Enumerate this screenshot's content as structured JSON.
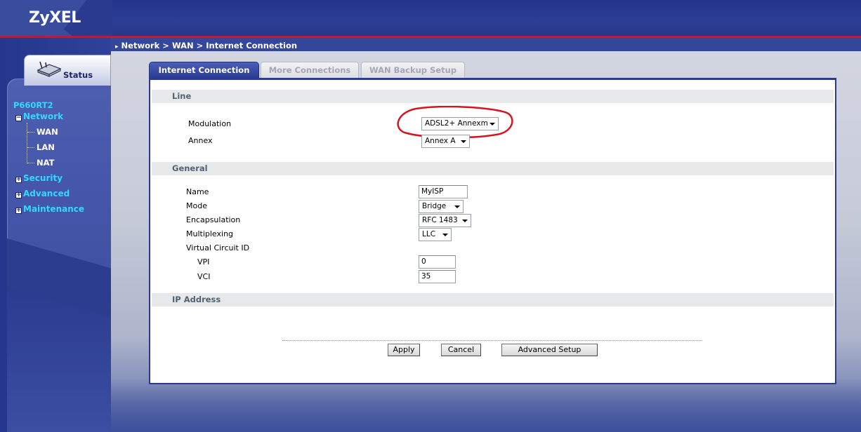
{
  "header": {
    "logo": "ZyXEL"
  },
  "breadcrumb": "Network > WAN > Internet Connection",
  "status_tab": {
    "label": "Status",
    "icon": "router-icon"
  },
  "sidebar": {
    "model": "P660RT2",
    "items": [
      {
        "label": "Network",
        "expanded": true,
        "children": [
          "WAN",
          "LAN",
          "NAT"
        ]
      },
      {
        "label": "Security",
        "expanded": false
      },
      {
        "label": "Advanced",
        "expanded": false
      },
      {
        "label": "Maintenance",
        "expanded": false
      }
    ]
  },
  "tabs": [
    {
      "label": "Internet Connection",
      "active": true
    },
    {
      "label": "More Connections",
      "active": false
    },
    {
      "label": "WAN Backup Setup",
      "active": false
    }
  ],
  "sections": {
    "line": "Line",
    "general": "General",
    "ip_address": "IP Address"
  },
  "line": {
    "modulation_label": "Modulation",
    "modulation_value": "ADSL2+ Annexm",
    "annex_label": "Annex",
    "annex_value": "Annex A"
  },
  "general": {
    "name_label": "Name",
    "name_value": "MyISP",
    "mode_label": "Mode",
    "mode_value": "Bridge",
    "encapsulation_label": "Encapsulation",
    "encapsulation_value": "RFC 1483",
    "multiplexing_label": "Multiplexing",
    "multiplexing_value": "LLC",
    "vc_label": "Virtual Circuit ID",
    "vpi_label": "VPI",
    "vpi_value": "0",
    "vci_label": "VCI",
    "vci_value": "35"
  },
  "buttons": {
    "apply": "Apply",
    "cancel": "Cancel",
    "advanced": "Advanced Setup"
  },
  "colors": {
    "accent_blue": "#2a3a8f",
    "nav_cyan": "#33d7ff",
    "header_red": "#c4182f",
    "annotation_red": "#d4141e"
  }
}
